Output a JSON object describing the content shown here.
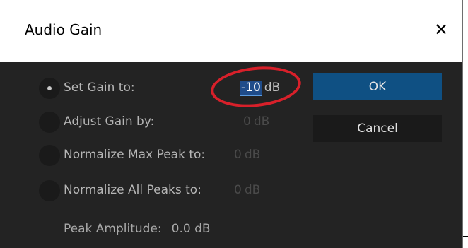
{
  "dialog": {
    "title": "Audio Gain",
    "close_glyph": "✕"
  },
  "options": [
    {
      "label": "Set Gain to:",
      "value": "-10",
      "unit": "dB",
      "selected": true
    },
    {
      "label": "Adjust Gain by:",
      "value": "0",
      "unit": "dB",
      "selected": false
    },
    {
      "label": "Normalize Max Peak to:",
      "value": "0",
      "unit": "dB",
      "selected": false
    },
    {
      "label": "Normalize All Peaks to:",
      "value": "0",
      "unit": "dB",
      "selected": false
    }
  ],
  "peak": {
    "label": "Peak Amplitude:",
    "value": "0.0 dB"
  },
  "buttons": {
    "ok": "OK",
    "cancel": "Cancel"
  },
  "colors": {
    "dialog_bg": "#232323",
    "ok_button": "#0f5083",
    "highlight_circle": "#d8202a"
  },
  "icons": {
    "close": "close-icon"
  }
}
